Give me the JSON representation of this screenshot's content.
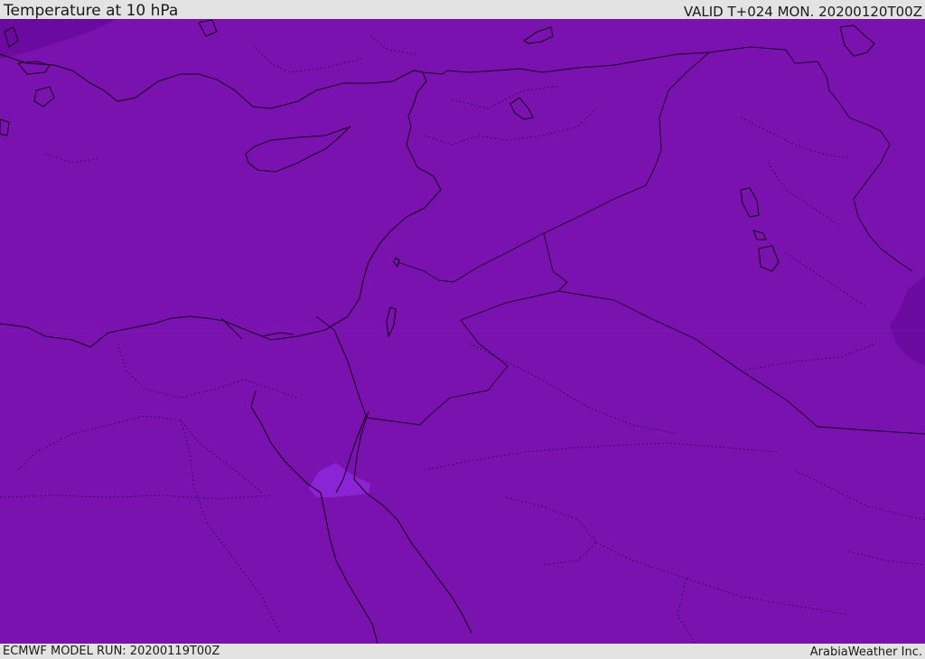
{
  "header": {
    "title": "Temperature at 10 hPa",
    "valid_time": "VALID T+024 MON. 20200120T00Z"
  },
  "footer": {
    "model_run": "ECMWF MODEL RUN: 20200119T00Z",
    "credit": "ArabiaWeather Inc."
  },
  "map": {
    "fill_color": "#7a12b0",
    "cold_patch_color": "#6a0a9e",
    "warm_patch_color": "#8a24d4",
    "border_color": "#1a0020"
  }
}
